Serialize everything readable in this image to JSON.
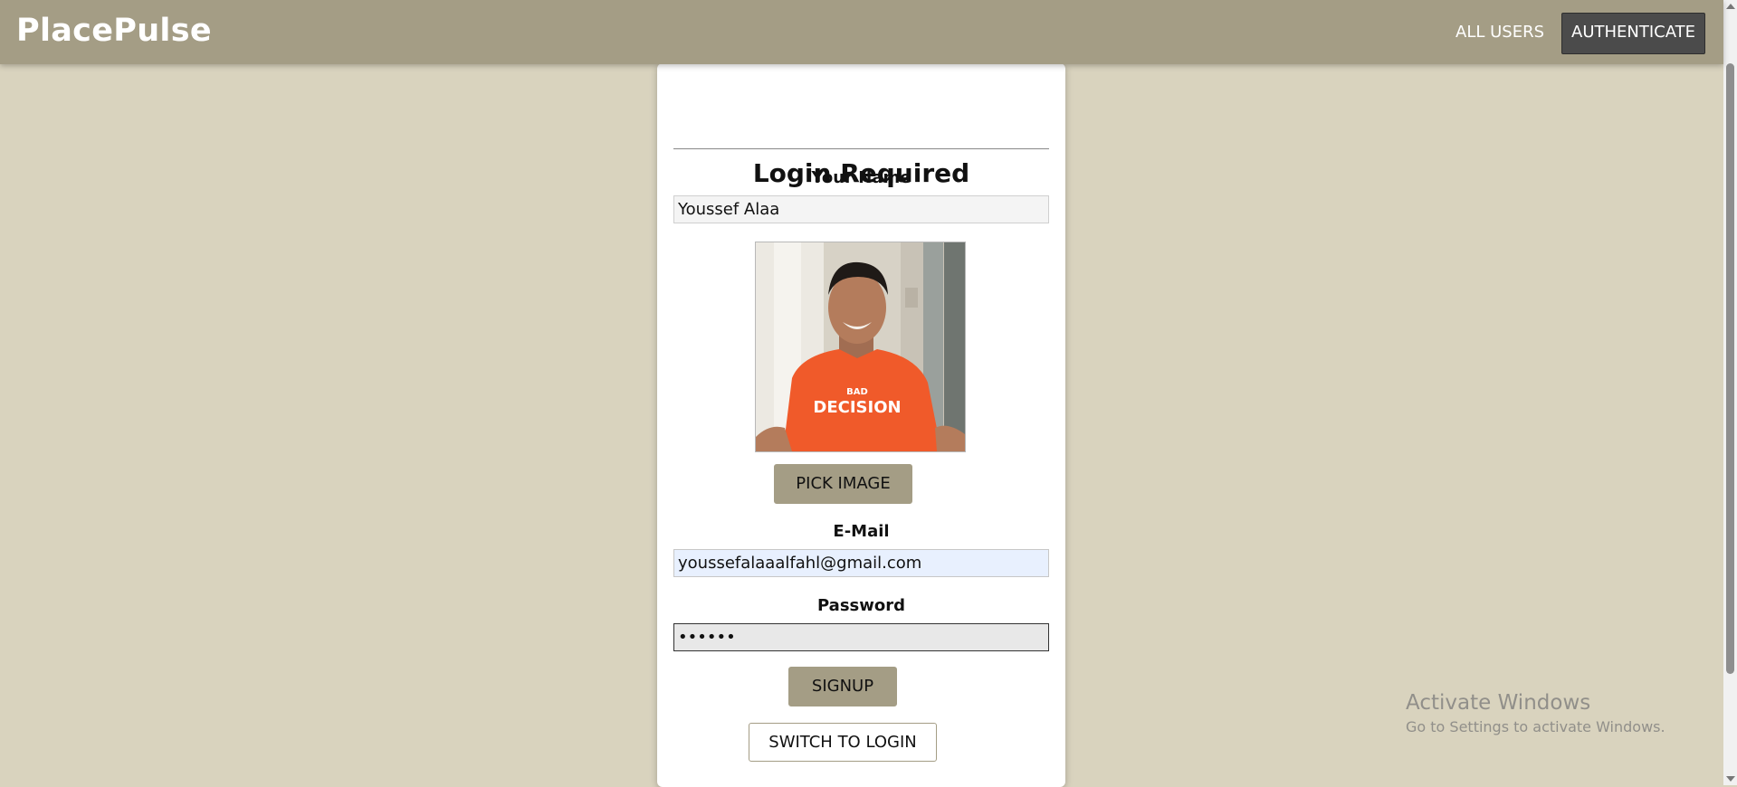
{
  "header": {
    "brand": "PlacePulse",
    "nav": {
      "all_users": "ALL USERS",
      "authenticate": "AUTHENTICATE"
    }
  },
  "form": {
    "title": "Login Required",
    "name_label": "Your Name",
    "name_value": "Youssef Alaa",
    "pick_image_label": "PICK IMAGE",
    "email_label": "E-Mail",
    "email_value": "youssefalaaalfahl@gmail.com",
    "password_label": "Password",
    "password_value": "••••••",
    "signup_label": "SIGNUP",
    "switch_label": "SWITCH TO LOGIN"
  },
  "watermark": {
    "title": "Activate Windows",
    "subtitle": "Go to Settings to activate Windows."
  },
  "colors": {
    "header_bg": "#a49d85",
    "page_bg": "#d9d3be",
    "active_nav_bg": "#4b4b4b",
    "button_bg": "#a49d85",
    "email_field_bg": "#e8f0fe"
  },
  "icons": {
    "avatar": "profile-photo",
    "scroll_up": "scroll-up-arrow-icon",
    "scroll_down": "scroll-down-arrow-icon"
  }
}
